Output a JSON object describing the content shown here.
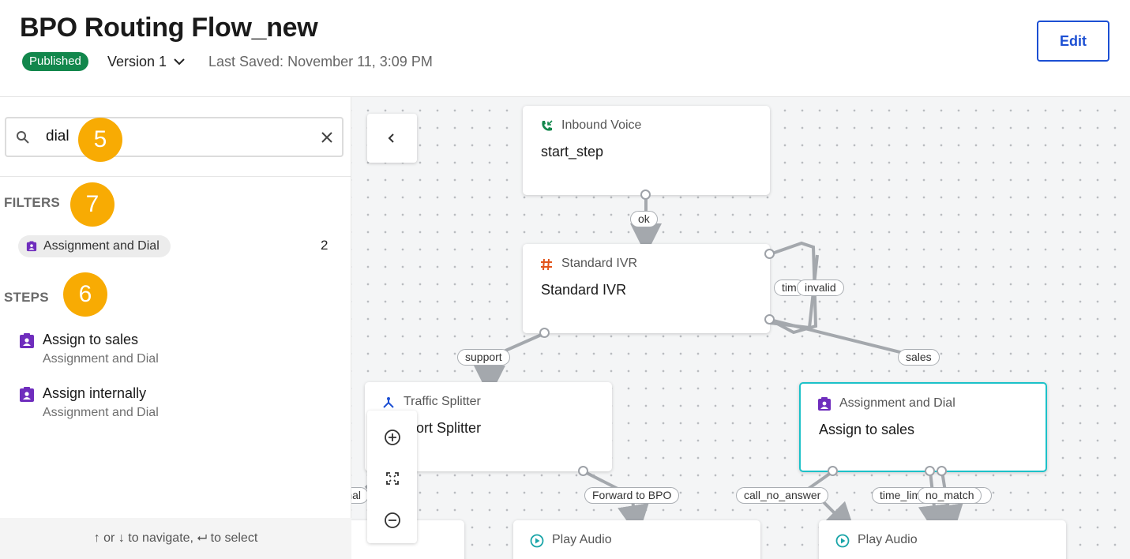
{
  "header": {
    "title": "BPO Routing Flow_new",
    "status_badge": "Published",
    "version_label": "Version 1",
    "last_saved": "Last Saved: November 11, 3:09 PM",
    "edit_label": "Edit",
    "colors": {
      "badge": "#12874c",
      "edit": "#1c4fd3"
    }
  },
  "sidebar": {
    "search": {
      "value": "dial",
      "icon": "search-icon",
      "clear_icon": "close-icon"
    },
    "filters_label": "FILTERS",
    "filters": [
      {
        "label": "Assignment and Dial",
        "count": "2",
        "icon": "assignment-icon"
      }
    ],
    "steps_label": "STEPS",
    "steps": [
      {
        "name": "Assign to sales",
        "type": "Assignment and Dial",
        "icon": "assignment-icon"
      },
      {
        "name": "Assign internally",
        "type": "Assignment and Dial",
        "icon": "assignment-icon"
      }
    ],
    "footer_hint": "↑ or ↓ to navigate, ⮠ to select"
  },
  "callouts": {
    "search": "5",
    "filters": "7",
    "steps": "6",
    "color": "#f8ab03"
  },
  "canvas": {
    "nodes": {
      "inbound": {
        "type": "Inbound Voice",
        "name": "start_step",
        "icon": "phone-incoming-icon"
      },
      "ivr": {
        "type": "Standard IVR",
        "name": "Standard IVR",
        "icon": "hash-icon"
      },
      "splitter": {
        "type": "Traffic Splitter",
        "name": "Support Splitter",
        "icon": "split-icon"
      },
      "assign": {
        "type": "Assignment and Dial",
        "name": "Assign to sales",
        "icon": "assignment-icon"
      },
      "play1": {
        "type": "Play Audio",
        "icon": "play-circle-icon"
      },
      "play2": {
        "type": "Play Audio",
        "icon": "play-circle-icon"
      }
    },
    "edges": {
      "ok": "ok",
      "support": "support",
      "timeout": "timeout",
      "invalid": "invalid",
      "sales": "sales",
      "internal": "internal",
      "forward": "Forward to BPO",
      "call_no_answer": "call_no_answer",
      "time_limit": "time_limit",
      "no_match": "no_match"
    },
    "controls": {
      "collapse_icon": "chevron-left-icon",
      "zoom_in_icon": "zoom-in-icon",
      "fit_icon": "fit-screen-icon",
      "zoom_out_icon": "zoom-out-icon"
    },
    "selected_color": "#1cc1c8"
  }
}
